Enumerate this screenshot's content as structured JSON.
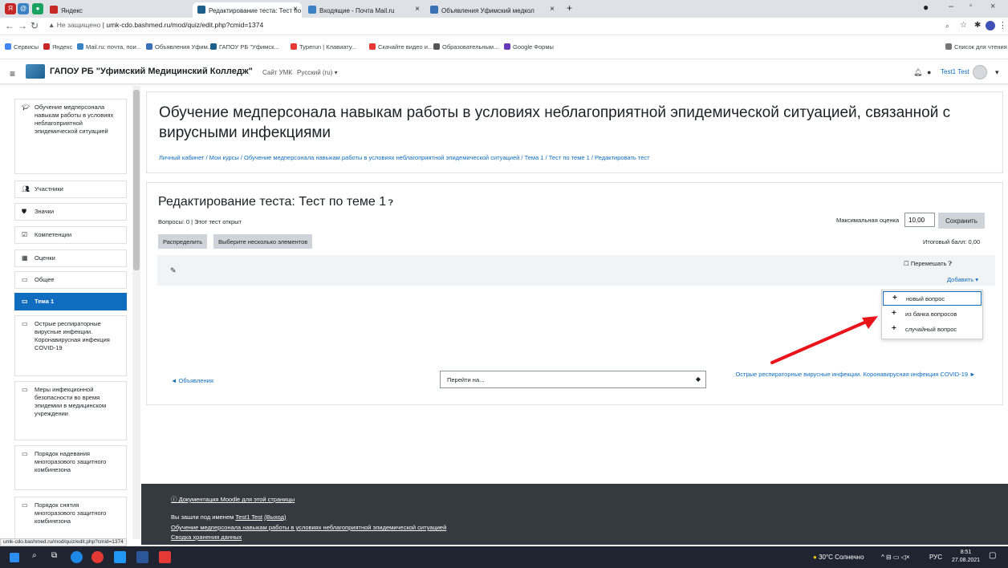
{
  "browser": {
    "tabs": [
      {
        "label": "Яндекс"
      },
      {
        "label": "Редактирование теста: Тест по"
      },
      {
        "label": "Входящие - Почта Mail.ru"
      },
      {
        "label": "Объявления Уфимский медкол"
      }
    ],
    "new_tab": "+",
    "url": "umk-cdo.bashmed.ru/mod/quiz/edit.php?cmid=1374",
    "not_secure": "Не защищено",
    "bookmarks": [
      "Сервисы",
      "Яндекс",
      "Mail.ru: почта, пои...",
      "Объявления Уфим...",
      "ГАПОУ РБ \"Уфимск...",
      "Typerun | Клавиату...",
      "Скачайте видео и...",
      "Образовательным...",
      "Google Формы"
    ],
    "reading_list": "Список для чтения"
  },
  "header": {
    "site_name": "ГАПОУ РБ \"Уфимский Медицинский Колледж\"",
    "site_link": "Сайт УМК",
    "language": "Русский (ru) ▾",
    "user": "Test1 Test"
  },
  "nav": {
    "items": [
      {
        "label": "Обучение медперсонала навыкам работы в условиях неблагоприятной эпидемической ситуацией",
        "icon": "graduation-cap-icon"
      },
      {
        "label": "Участники",
        "icon": "users-icon"
      },
      {
        "label": "Значки",
        "icon": "shield-icon"
      },
      {
        "label": "Компетенции",
        "icon": "checkbox-icon"
      },
      {
        "label": "Оценки",
        "icon": "table-icon"
      },
      {
        "label": "Общее",
        "icon": "folder-icon"
      },
      {
        "label": "Тема 1",
        "icon": "folder-icon"
      },
      {
        "label": "Острые респираторные вирусные инфекции. Коронавирусная инфекция COVID-19",
        "icon": "folder-icon"
      },
      {
        "label": "Меры инфекционной безопасности во время эпидемии в медицинском учреждении",
        "icon": "folder-icon"
      },
      {
        "label": "Порядок надевания многоразового защитного комбинезона",
        "icon": "folder-icon"
      },
      {
        "label": "Порядок снятия многоразового защитного комбинезона",
        "icon": "folder-icon"
      }
    ],
    "active_index": 6
  },
  "course": {
    "title": "Обучение медперсонала навыкам работы в условиях неблагоприятной эпидемической ситуацией, связанной с вирусными инфекциями",
    "breadcrumb": "Личный кабинет / Мои курсы / Обучение медперсонала навыкам работы в условиях неблагоприятной эпидемической ситуацией / Тема 1 / Тест по теме 1 / Редактировать тест"
  },
  "quiz": {
    "title": "Редактирование теста: Тест по теме 1",
    "info": "Вопросы: 0 | Этот тест открыт",
    "max_grade_label": "Максимальная оценка",
    "max_grade_value": "10,00",
    "save_label": "Сохранить",
    "repaginate_label": "Распределить",
    "select_multiple_label": "Выберите несколько элементов",
    "total_grade": "Итоговый балл: 0,00",
    "shuffle_label": "Перемешать",
    "add_label": "Добавить ▾",
    "add_menu": [
      "новый вопрос",
      "из банка вопросов",
      "случайный вопрос"
    ]
  },
  "activity_nav": {
    "prev": "◄ Объявления",
    "jump_placeholder": "Перейти на...",
    "next": "Острые респираторные вирусные инфекции. Коронавирусная инфекция COVID-19 ►"
  },
  "footer": {
    "docs": "Документация Moodle для этой страницы",
    "logged_in_prefix": "Вы зашли под именем",
    "logged_in_user": "Test1 Test",
    "logout": "(Выход)",
    "course_link": "Обучение медперсонала навыкам работы в условиях неблагоприятной эпидемической ситуацией",
    "data_retention": "Сводка хранения данных"
  },
  "status_url": "umk-cdo.bashmed.ru/mod/quiz/edit.php?cmid=1374",
  "taskbar": {
    "weather": "30°C Солнечно",
    "lang": "РУС",
    "time": "8:51",
    "date": "27.08.2021"
  },
  "colors": {
    "accent": "#0f6cbf",
    "footer": "#343a40",
    "arrow": "#e8141a"
  }
}
